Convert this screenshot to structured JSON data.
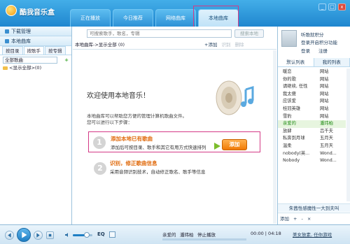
{
  "app": {
    "title": "酷我音乐盒"
  },
  "tabs": [
    {
      "label": "正在播放",
      "active": false
    },
    {
      "label": "今日推荐",
      "active": false
    },
    {
      "label": "网络曲库",
      "active": false
    },
    {
      "label": "本地曲库",
      "active": true
    }
  ],
  "window_controls": [
    "_",
    "□",
    "x"
  ],
  "left": {
    "download_mgr": "下载管理",
    "local_lib": "本地曲库",
    "subtabs": [
      "按目录",
      "按歌手",
      "按专辑"
    ],
    "active_subtab": "按歌手",
    "filter_value": "全部歌曲",
    "tree_item": "<显示全部>(0)"
  },
  "center": {
    "search_placeholder": "可搜索歌手，歌名，专辑",
    "search_button": "搜索本地",
    "breadcrumb": "本地曲库->显示全部 (0)",
    "tools": {
      "add": "+添加",
      "identify": "识别",
      "delete": "删除"
    },
    "welcome_title": "欢迎使用本地音乐！",
    "intro_line1": "本地曲库可以帮助您方便的管理计算机歌曲文件。",
    "intro_line2": "您可以进行以下步骤：",
    "step1": {
      "number": "1",
      "title": "添加本地已有歌曲",
      "desc": "添加后可按目录、歌手和其它有用方式快速排列",
      "button": "添加"
    },
    "step2": {
      "number": "2",
      "title": "识别，修正歌曲信息",
      "desc": "采用音频识别技术，自动修正歌名、歌手等信息"
    }
  },
  "right": {
    "login_msg": "听歌就积分",
    "login_msg2": "登录开启积分功能",
    "login": "登录",
    "register": "注册",
    "tabs": [
      "默认列表",
      "我的列表"
    ],
    "playlist": [
      {
        "song": "暖恋",
        "artist": "网站",
        "playing": false
      },
      {
        "song": "你的歌",
        "artist": "网站",
        "playing": false
      },
      {
        "song": "请继续, 任性",
        "artist": "网站",
        "playing": false
      },
      {
        "song": "我太傻",
        "artist": "网站",
        "playing": false
      },
      {
        "song": "应该爱",
        "artist": "网站",
        "playing": false
      },
      {
        "song": "桂冠英雄",
        "artist": "网站",
        "playing": false
      },
      {
        "song": "雪豹",
        "artist": "网站",
        "playing": false
      },
      {
        "song": "亲爱的",
        "artist": "潘玮柏",
        "playing": true
      },
      {
        "song": "放肆",
        "artist": "吕千夫",
        "playing": false
      },
      {
        "song": "私奔到月球",
        "artist": "五月天",
        "playing": false
      },
      {
        "song": "温柔",
        "artist": "五月天",
        "playing": false
      },
      {
        "song": "nobody(英...",
        "artist": "Wond...",
        "playing": false
      },
      {
        "song": "Nobody",
        "artist": "Wond...",
        "playing": false
      }
    ],
    "ticker": "朱茜性感魔性一大到夫叫",
    "footer": [
      "添加",
      "+",
      "-",
      "×"
    ]
  },
  "player": {
    "eq": "EQ",
    "volume_percent": 70,
    "now_song": "亲爱的",
    "now_artist": "潘玮柏",
    "state": "停止播放",
    "time": "00:00 | 04:18",
    "promo": "美女放素, 任你游戏"
  }
}
